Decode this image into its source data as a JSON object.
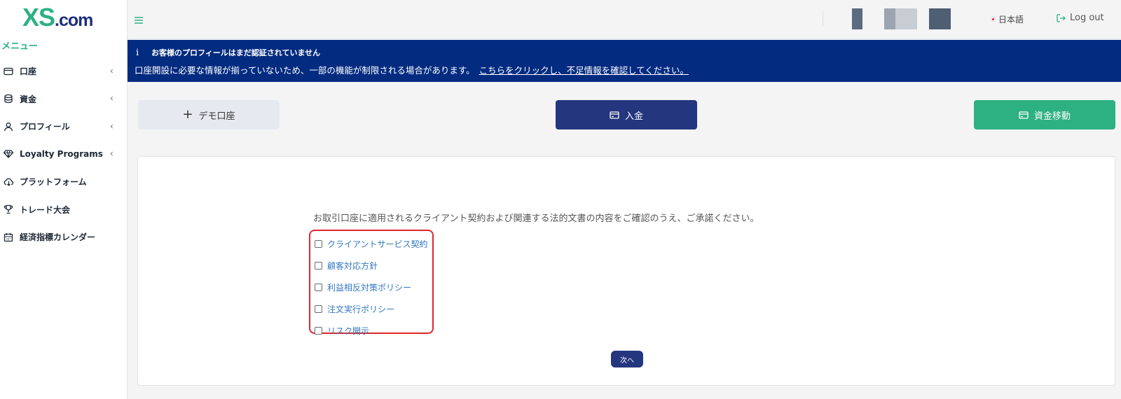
{
  "brand": {
    "logo_main": "XS",
    "logo_suffix": ".com",
    "accent": "#2db182",
    "navy": "#24367d"
  },
  "sidebar": {
    "menu_title": "メニュー",
    "items": [
      {
        "label": "口座",
        "icon": "wallet-icon",
        "has_chevron": true
      },
      {
        "label": "資金",
        "icon": "coins-icon",
        "has_chevron": true
      },
      {
        "label": "プロフィール",
        "icon": "user-icon",
        "has_chevron": true
      },
      {
        "label": "Loyalty Programs",
        "icon": "diamond-icon",
        "has_chevron": true
      },
      {
        "label": "プラットフォーム",
        "icon": "cloud-download-icon",
        "has_chevron": false
      },
      {
        "label": "トレード大会",
        "icon": "trophy-icon",
        "has_chevron": false
      },
      {
        "label": "経済指標カレンダー",
        "icon": "calendar-icon",
        "has_chevron": false
      }
    ],
    "chevron": "‹"
  },
  "header": {
    "language": "日本語",
    "logout": "Log out"
  },
  "notice": {
    "title": "お客様のプロフィールはまだ認証されていません",
    "body": "口座開設に必要な情報が揃っていないため、一部の機能が制限される場合があります。",
    "link": "こちらをクリックし、不足情報を確認してください。",
    "info_glyph": "i"
  },
  "actions": {
    "demo": "デモ口座",
    "deposit": "入金",
    "transfer": "資金移動"
  },
  "agreement": {
    "instruction": "お取引口座に適用されるクライアント契約および関連する法的文書の内容をご確認のうえ、ご承諾ください。",
    "documents": [
      {
        "label": "クライアントサービス契約",
        "checked": false
      },
      {
        "label": "顧客対応方針",
        "checked": false
      },
      {
        "label": "利益相反対策ポリシー",
        "checked": false
      },
      {
        "label": "注文実行ポリシー",
        "checked": false
      },
      {
        "label": "リスク開示",
        "checked": false
      }
    ],
    "next": "次へ"
  }
}
